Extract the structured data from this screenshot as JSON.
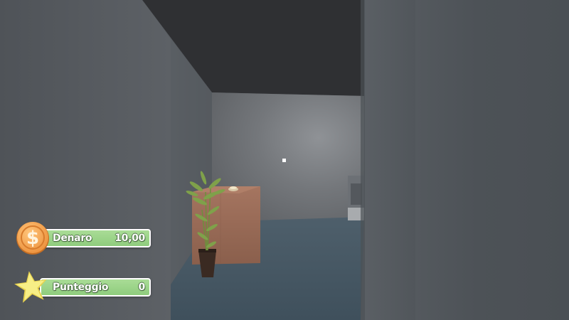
{
  "hud": {
    "money": {
      "label": "Denaro",
      "value": "10,00",
      "icon": "dollar-coin-icon"
    },
    "score": {
      "label": "Punteggio",
      "value": "0",
      "icon": "star-icon"
    }
  },
  "colors": {
    "hud_bar": "#9ed58a",
    "coin": "#f0a24e",
    "star": "#f3e56a",
    "ceiling": "#2f3033",
    "wall": "#5a5f64",
    "floor": "#4a5b68",
    "crate": "#9c6d57"
  }
}
